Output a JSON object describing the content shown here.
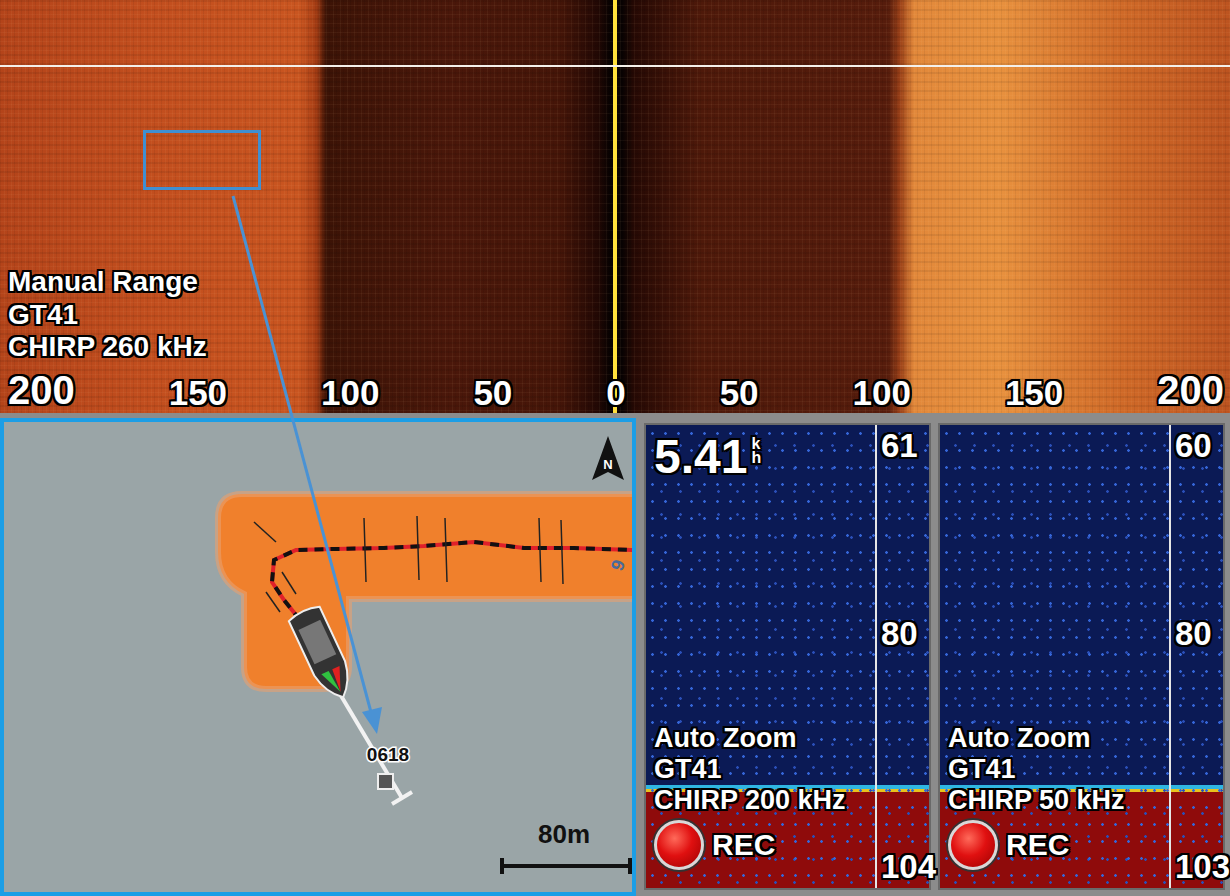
{
  "side_scan": {
    "labels": [
      "Manual Range",
      "GT41",
      "CHIRP 260 kHz"
    ],
    "scale": [
      "200",
      "150",
      "100",
      "50",
      "0",
      "50",
      "100",
      "150",
      "200"
    ]
  },
  "map": {
    "north": "N",
    "waypoint": "0618",
    "track_label": "9",
    "scale": "80m"
  },
  "sonar_panels": [
    {
      "speed": "5.41",
      "speed_unit_top": "k",
      "speed_unit_bottom": "h",
      "depth_top": "61",
      "depth_mid": "80",
      "depth_bottom": "104",
      "labels": [
        "Auto Zoom",
        "GT41",
        "CHIRP 200 kHz"
      ],
      "rec": "REC",
      "recording": true
    },
    {
      "depth_top": "60",
      "depth_mid": "80",
      "depth_bottom": "103",
      "labels": [
        "Auto Zoom",
        "GT41",
        "CHIRP 50 kHz"
      ],
      "rec": "REC",
      "recording": true
    }
  ]
}
